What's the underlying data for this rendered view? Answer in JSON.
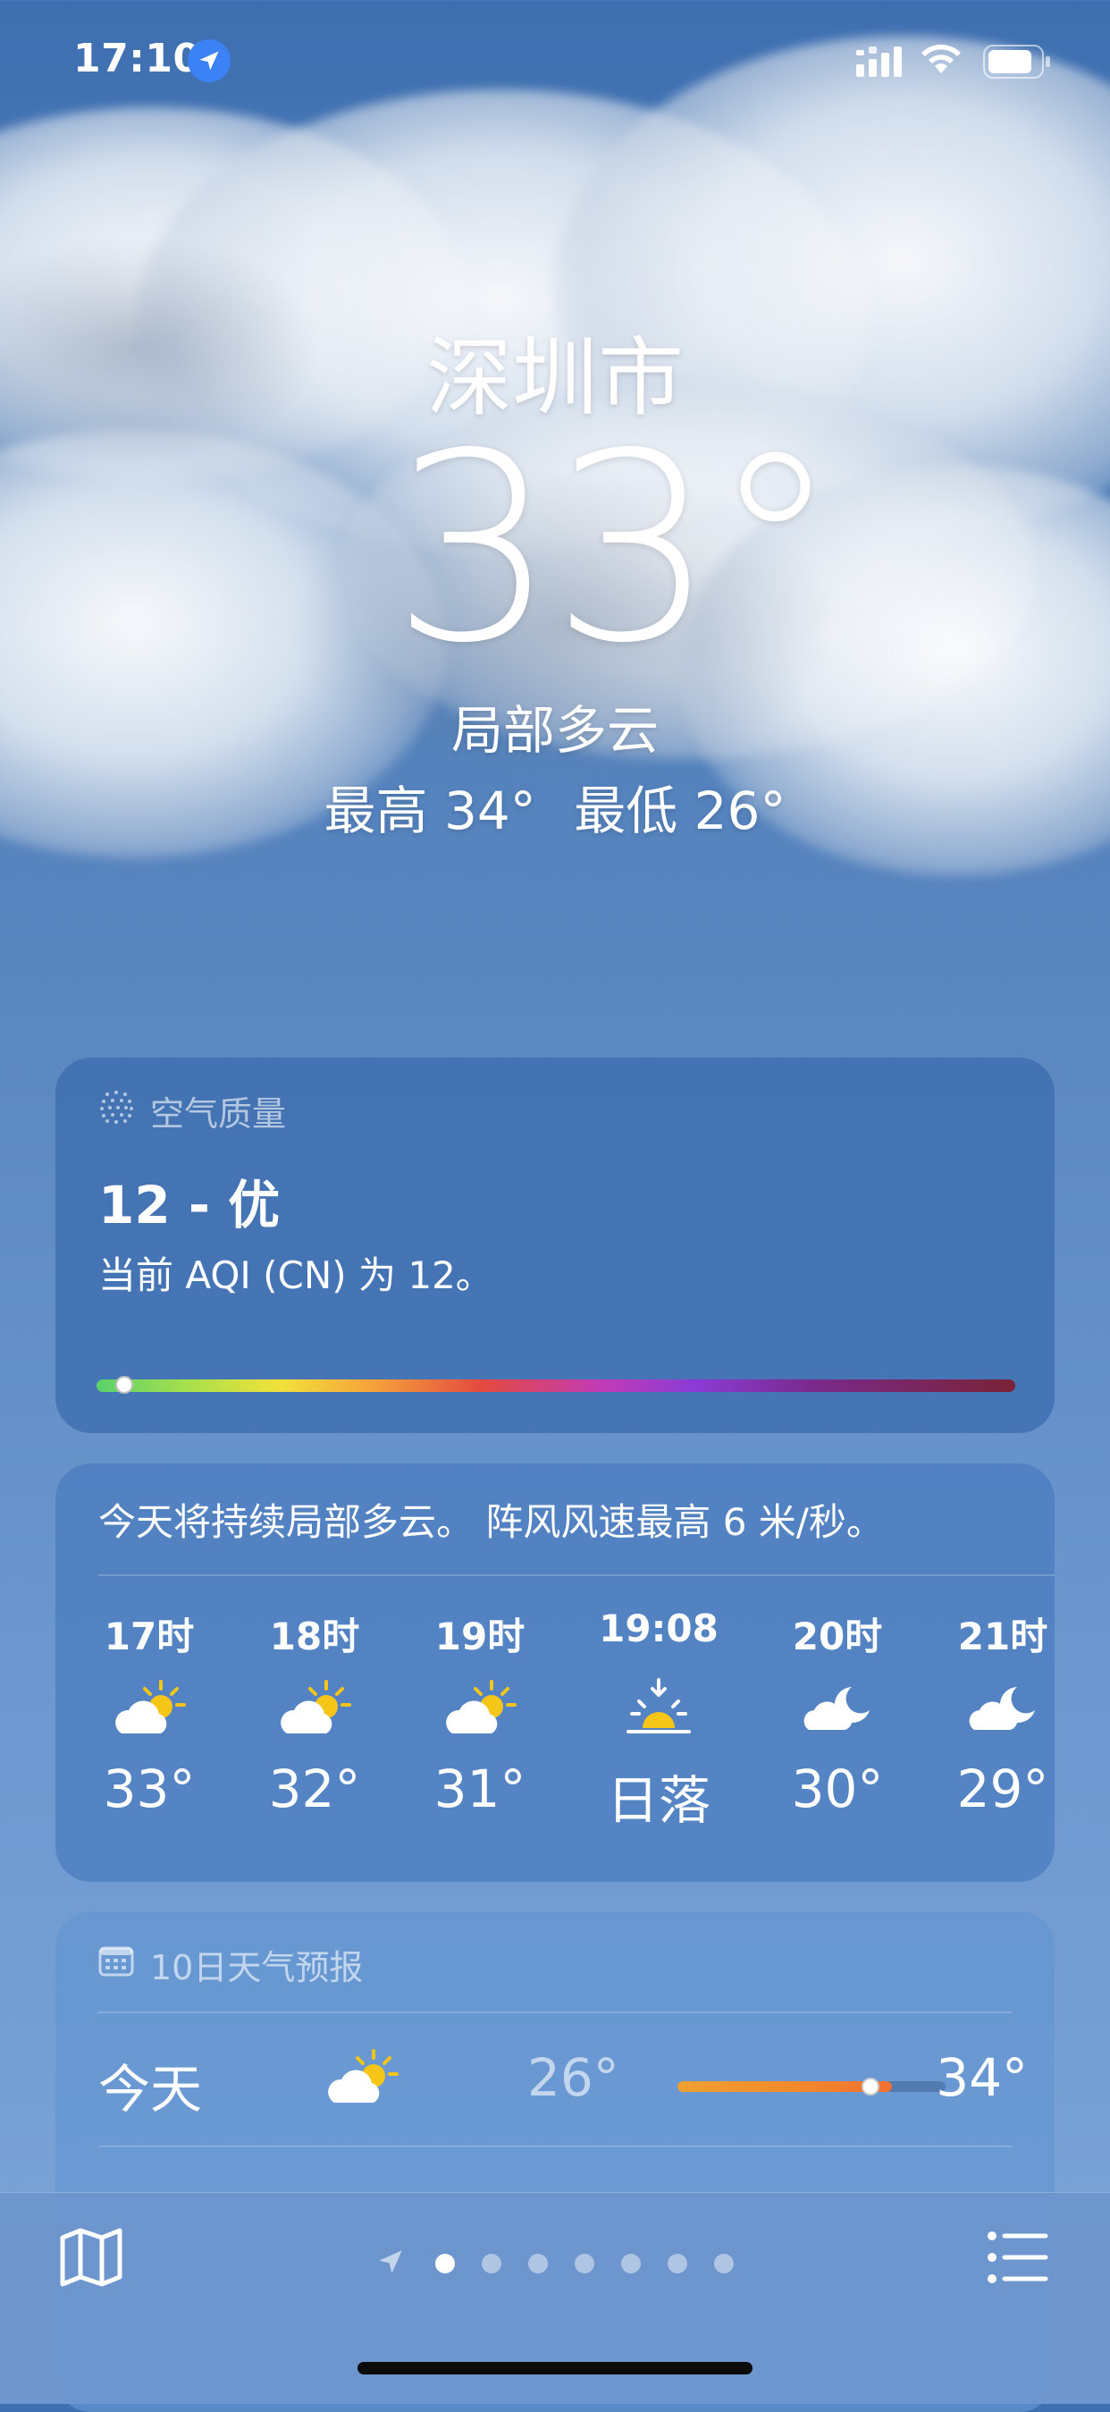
{
  "status_bar": {
    "time": "17:10"
  },
  "header": {
    "city": "深圳市",
    "temperature": "33°",
    "condition": "局部多云",
    "high": "最高 34°",
    "low": "最低 26°"
  },
  "aqi": {
    "title": "空气质量",
    "value": "12 - 优",
    "description": "当前 AQI (CN) 为 12。",
    "level": 0.03,
    "icon": "aqi-dots-icon"
  },
  "hourly": {
    "summary": "今天将持续局部多云。 阵风风速最高 6 米/秒。",
    "items": [
      {
        "label": "17时",
        "icon": "partly-sunny-icon",
        "temp": "33°"
      },
      {
        "label": "18时",
        "icon": "partly-sunny-icon",
        "temp": "32°"
      },
      {
        "label": "19时",
        "icon": "partly-sunny-icon",
        "temp": "31°"
      },
      {
        "label": "19:08",
        "icon": "sunset-icon",
        "temp": "日落"
      },
      {
        "label": "20时",
        "icon": "cloud-moon-icon",
        "temp": "30°"
      },
      {
        "label": "21时",
        "icon": "cloud-moon-icon",
        "temp": "29°"
      }
    ]
  },
  "daily": {
    "title": "10日天气预报",
    "icon": "calendar-icon",
    "rows": [
      {
        "day": "今天",
        "icon": "partly-sunny-icon",
        "low": "26°",
        "high": "34°",
        "bar_start": 0.0,
        "bar_end": 0.8,
        "current": 0.72
      }
    ]
  },
  "bottom_bar": {
    "pages": 7,
    "active_page": 0,
    "map_icon": "map-icon",
    "list_icon": "list-icon",
    "location_icon": "location-arrow-icon"
  },
  "colors": {
    "aqi_green": "#5bd16b",
    "temp_bar": "#f28c2a",
    "sun_yellow": "#f5c518"
  }
}
